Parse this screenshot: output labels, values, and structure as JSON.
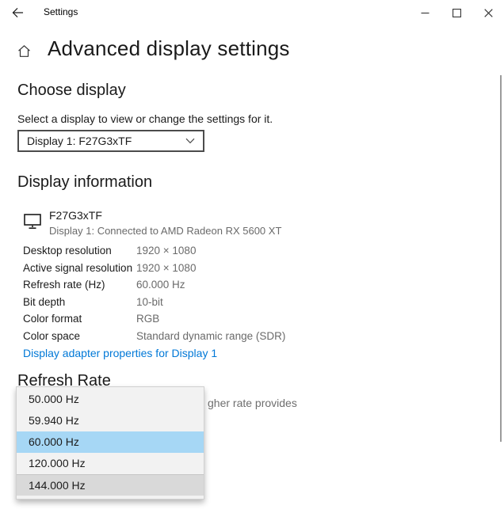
{
  "titlebar": {
    "title": "Settings"
  },
  "header": {
    "title": "Advanced display settings"
  },
  "choose_display": {
    "heading": "Choose display",
    "description": "Select a display to view or change the settings for it.",
    "selected_display": "Display 1: F27G3xTF"
  },
  "display_information": {
    "heading": "Display information",
    "monitor_name": "F27G3xTF",
    "monitor_connection": "Display 1: Connected to AMD Radeon RX 5600 XT",
    "properties": [
      {
        "label": "Desktop resolution",
        "value": "1920 × 1080"
      },
      {
        "label": "Active signal resolution",
        "value": "1920 × 1080"
      },
      {
        "label": "Refresh rate (Hz)",
        "value": "60.000 Hz"
      },
      {
        "label": "Bit depth",
        "value": "10-bit"
      },
      {
        "label": "Color format",
        "value": "RGB"
      },
      {
        "label": "Color space",
        "value": "Standard dynamic range (SDR)"
      }
    ],
    "adapter_link": "Display adapter properties for Display 1"
  },
  "refresh_rate": {
    "heading": "Refresh Rate",
    "visible_description_fragment": "gher rate provides",
    "options": [
      {
        "label": "50.000 Hz",
        "state": "normal"
      },
      {
        "label": "59.940 Hz",
        "state": "normal"
      },
      {
        "label": "60.000 Hz",
        "state": "selected"
      },
      {
        "label": "120.000 Hz",
        "state": "normal"
      },
      {
        "label": "144.000 Hz",
        "state": "hover"
      }
    ]
  },
  "icons": {
    "back": "back-arrow",
    "home": "home",
    "monitor": "monitor",
    "select_chevron": "chevron-down",
    "minimize": "minimize",
    "maximize": "maximize",
    "close": "close"
  },
  "colors": {
    "link_blue": "#0078d7",
    "selection_blue": "#a6d7f5",
    "hover_gray": "#d9d9d9",
    "popup_background": "#f2f2f2",
    "secondary_text": "#6a6a6a"
  }
}
